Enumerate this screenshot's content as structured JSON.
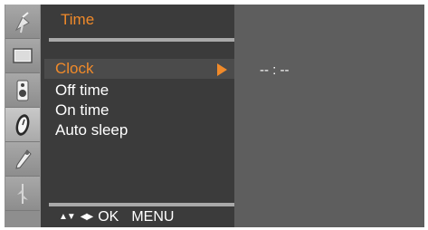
{
  "menu": {
    "title": "Time",
    "items": [
      {
        "label": "Clock",
        "selected": true
      },
      {
        "label": "Off time",
        "selected": false
      },
      {
        "label": "On time",
        "selected": false
      },
      {
        "label": "Auto sleep",
        "selected": false
      }
    ]
  },
  "value": {
    "clock_display": "-- : --"
  },
  "hints": {
    "updown": "▲▼",
    "leftright": "◀▶",
    "ok": "OK",
    "menu": "MENU"
  },
  "sidebar": {
    "icons": [
      {
        "name": "satellite-dish-icon"
      },
      {
        "name": "picture-screen-icon"
      },
      {
        "name": "speaker-sound-icon"
      },
      {
        "name": "clock-time-icon",
        "active": true
      },
      {
        "name": "tools-wrench-icon"
      },
      {
        "name": "signal-source-icon"
      }
    ]
  },
  "colors": {
    "accent": "#f08a2a",
    "menu_background": "#3b3b3b",
    "screen_background": "#5e5e5e"
  }
}
